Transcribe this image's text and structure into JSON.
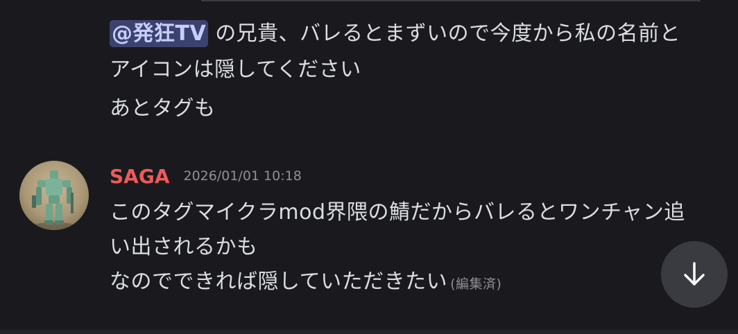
{
  "message1": {
    "mention": "@発狂TV",
    "line1_text": "の兄貴、バレるとまずいので今度から私の名前と",
    "line2_text": "アイコンは隠してください",
    "line3_text": "あとタグも"
  },
  "message2": {
    "username": "SAGA",
    "timestamp": "2026/01/01 10:18",
    "lines": [
      "このタグマイクラmod界隈の鯖だからバレるとワンチャン追",
      "い出されるかも",
      "なのでできれば隠していただきたい"
    ],
    "edited_label": "(編集済)"
  },
  "colors": {
    "background": "#1a1a1e",
    "text": "#dbdee1",
    "mention_bg": "#3c4270",
    "mention_text": "#c9cdfb",
    "username": "#ee5a5a",
    "muted": "#8e9096",
    "scroll_button_bg": "#3a3b41"
  },
  "icons": {
    "scroll_button": "arrow-down-icon",
    "avatar": "robot-figure-avatar"
  }
}
